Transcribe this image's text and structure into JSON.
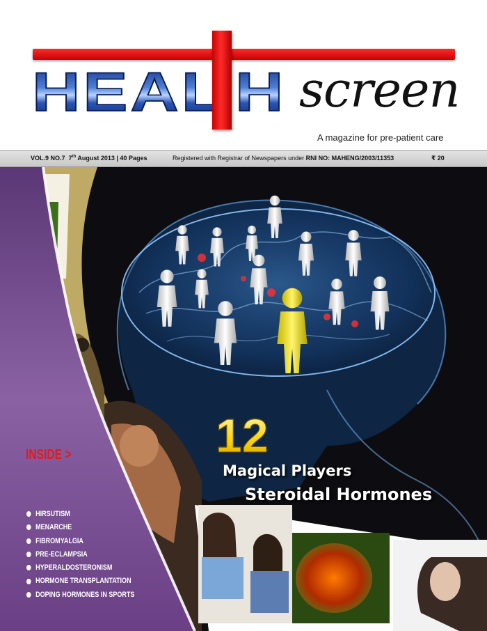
{
  "masthead": {
    "title_left": "HEAL",
    "title_right": "H",
    "title_script": "screen",
    "tagline": "A magazine for pre-patient care"
  },
  "info_strip": {
    "issue_prefix": "VOL.9 NO.7",
    "issue_day": "7",
    "issue_day_suffix": "th",
    "issue_rest": "August 2013 | 40 Pages",
    "registration_prefix": "Registered with Registrar of Newspapers under",
    "registration_number": "RNI NO: MAHENG/2003/11353",
    "price": "₹ 20"
  },
  "cover_story": {
    "number": "12",
    "line1": "Magical Players",
    "line2": "Steroidal Hormones"
  },
  "inside": {
    "label": "INSIDE >",
    "items": [
      "HIRSUTISM",
      "MENARCHE",
      "FIBROMYALGIA",
      "PRE-ECLAMPSIA",
      "HYPERALDOSTERONISM",
      "HORMONE TRANSPLANTATION",
      "DOPING HORMONES IN SPORTS"
    ]
  },
  "colors": {
    "cross_red": "#e01010",
    "title_blue": "#2b56b5",
    "panel_purple": "#6a3f85",
    "figure_yellow": "#f2e23a",
    "figure_white": "#f0f0f0",
    "inside_red": "#e01b1b"
  }
}
